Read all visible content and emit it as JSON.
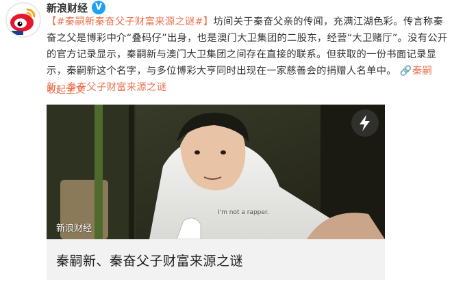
{
  "author": {
    "name": "新浪财经",
    "verified_badge": "V"
  },
  "post": {
    "hashtag": "【#秦嗣新秦奋父子财富来源之谜#】",
    "text_1": "坊间关于秦奋父亲的传闻，充满江湖色彩。传言称秦奋之父是博彩中介“叠码仔”出身，也是澳门大卫集团的二股东，经营“大卫赌厅”。没有公开的官方记录显示，秦嗣新与澳门大卫集团之间存在直接的联系。但获取的一份书面记录显示，秦嗣新这个名字，与多位博彩大亨同时出现在一家慈善会的捐赠人名单中。",
    "link": "秦嗣新、秦奋父子财富来源之谜",
    "collapse": "收起全文"
  },
  "card": {
    "watermark": "新浪财经",
    "title": "秦嗣新、秦奋父子财富来源之谜",
    "shirt_text": "I'm not a rapper."
  },
  "colors": {
    "link": "#eb7350",
    "verified": "#1da1f2"
  }
}
